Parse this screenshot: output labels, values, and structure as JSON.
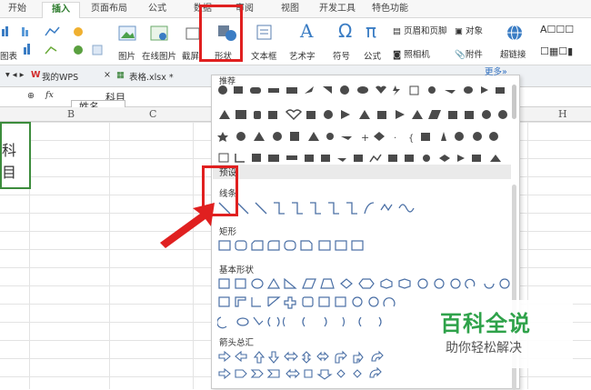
{
  "tabs": [
    {
      "label": "开始",
      "active": false
    },
    {
      "label": "插入",
      "active": true
    },
    {
      "label": "页面布局",
      "active": false
    },
    {
      "label": "公式",
      "active": false
    },
    {
      "label": "数据",
      "active": false
    },
    {
      "label": "审阅",
      "active": false
    },
    {
      "label": "视图",
      "active": false
    },
    {
      "label": "开发工具",
      "active": false
    },
    {
      "label": "特色功能",
      "active": false
    }
  ],
  "ribbon": {
    "chart_label": "图表",
    "picture_label": "图片",
    "online_picture_label": "在线图片",
    "screenshot_label": "截屏",
    "shapes_label": "形状",
    "textbox_label": "文本框",
    "wordart_label": "艺术字",
    "symbol_label": "符号",
    "formula_label": "公式",
    "header_footer_label": "页眉和页脚",
    "object_label": "对象",
    "camera_label": "照相机",
    "attachment_label": "附件",
    "hyperlink_label": "超链接"
  },
  "docbar": {
    "wps_tab": "我的WPS",
    "file_tab": "表格.xlsx *"
  },
  "formula_bar": {
    "fx": "fx",
    "value": "科目",
    "popup_text": "姓名"
  },
  "grid": {
    "columns": [
      "B",
      "C",
      "H"
    ],
    "cell_text": "科目"
  },
  "shape_panel": {
    "recommended": "推荐",
    "more": "更多»",
    "preset": "预设",
    "lines": "线条",
    "rectangles": "矩形",
    "basic_shapes": "基本形状",
    "arrows": "箭头总汇"
  },
  "watermark": {
    "title": "百科全说",
    "subtitle": "助你轻松解决"
  },
  "colors": {
    "accent_green": "#2b7a2b",
    "highlight_red": "#e02020",
    "watermark_green": "#2fa24a"
  }
}
